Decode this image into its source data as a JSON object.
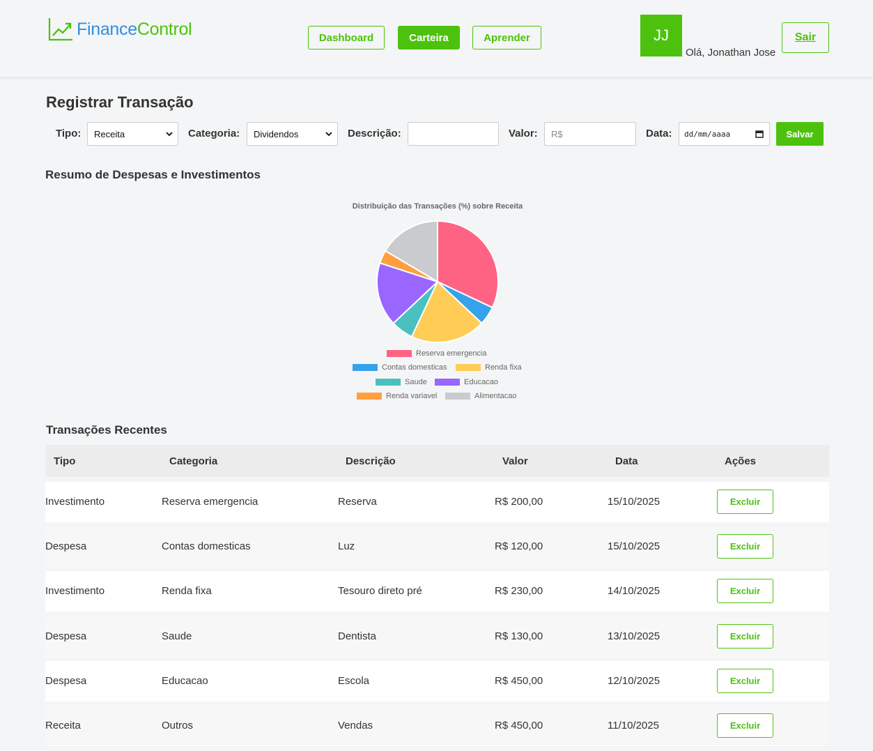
{
  "brand": {
    "part1": "Finance",
    "part2": "Control"
  },
  "nav": {
    "dashboard": "Dashboard",
    "carteira": "Carteira",
    "aprender": "Aprender"
  },
  "user": {
    "initials": "JJ",
    "greeting": "Olá, Jonathan Jose",
    "logout": "Sair"
  },
  "form": {
    "title": "Registrar Transação",
    "tipo_label": "Tipo:",
    "tipo_value": "Receita",
    "categoria_label": "Categoria:",
    "categoria_value": "Dividendos",
    "descricao_label": "Descrição:",
    "descricao_value": "",
    "valor_label": "Valor:",
    "valor_placeholder": "R$",
    "data_label": "Data:",
    "data_placeholder": "dd/mm/aaaa",
    "save": "Salvar"
  },
  "summary": {
    "title": "Resumo de Despesas e Investimentos"
  },
  "chart_data": {
    "type": "pie",
    "title": "Distribuição das Transações (%) sobre Receita",
    "legend_position": "bottom",
    "slices": [
      {
        "label": "Reserva emergencia",
        "value": 32,
        "color": "#ff6384"
      },
      {
        "label": "Contas domesticas",
        "value": 5,
        "color": "#36a2eb"
      },
      {
        "label": "Renda fixa",
        "value": 20,
        "color": "#ffcd56"
      },
      {
        "label": "Saude",
        "value": 6,
        "color": "#4bc0c0"
      },
      {
        "label": "Educacao",
        "value": 17,
        "color": "#9966ff"
      },
      {
        "label": "Renda variavel",
        "value": 3.5,
        "color": "#ff9f40"
      },
      {
        "label": "Alimentacao",
        "value": 16.5,
        "color": "#c9cbcf"
      }
    ]
  },
  "transactions": {
    "title": "Transações Recentes",
    "headers": [
      "Tipo",
      "Categoria",
      "Descrição",
      "Valor",
      "Data",
      "Ações"
    ],
    "rows": [
      {
        "tipo": "Investimento",
        "categoria": "Reserva emergencia",
        "descricao": "Reserva",
        "valor": "R$ 200,00",
        "data": "15/10/2025",
        "acao": "Excluir"
      },
      {
        "tipo": "Despesa",
        "categoria": "Contas domesticas",
        "descricao": "Luz",
        "valor": "R$ 120,00",
        "data": "15/10/2025",
        "acao": "Excluir"
      },
      {
        "tipo": "Investimento",
        "categoria": "Renda fixa",
        "descricao": "Tesouro direto pré",
        "valor": "R$ 230,00",
        "data": "14/10/2025",
        "acao": "Excluir"
      },
      {
        "tipo": "Despesa",
        "categoria": "Saude",
        "descricao": "Dentista",
        "valor": "R$ 130,00",
        "data": "13/10/2025",
        "acao": "Excluir"
      },
      {
        "tipo": "Despesa",
        "categoria": "Educacao",
        "descricao": "Escola",
        "valor": "R$ 450,00",
        "data": "12/10/2025",
        "acao": "Excluir"
      },
      {
        "tipo": "Receita",
        "categoria": "Outros",
        "descricao": "Vendas",
        "valor": "R$ 450,00",
        "data": "11/10/2025",
        "acao": "Excluir"
      }
    ]
  }
}
